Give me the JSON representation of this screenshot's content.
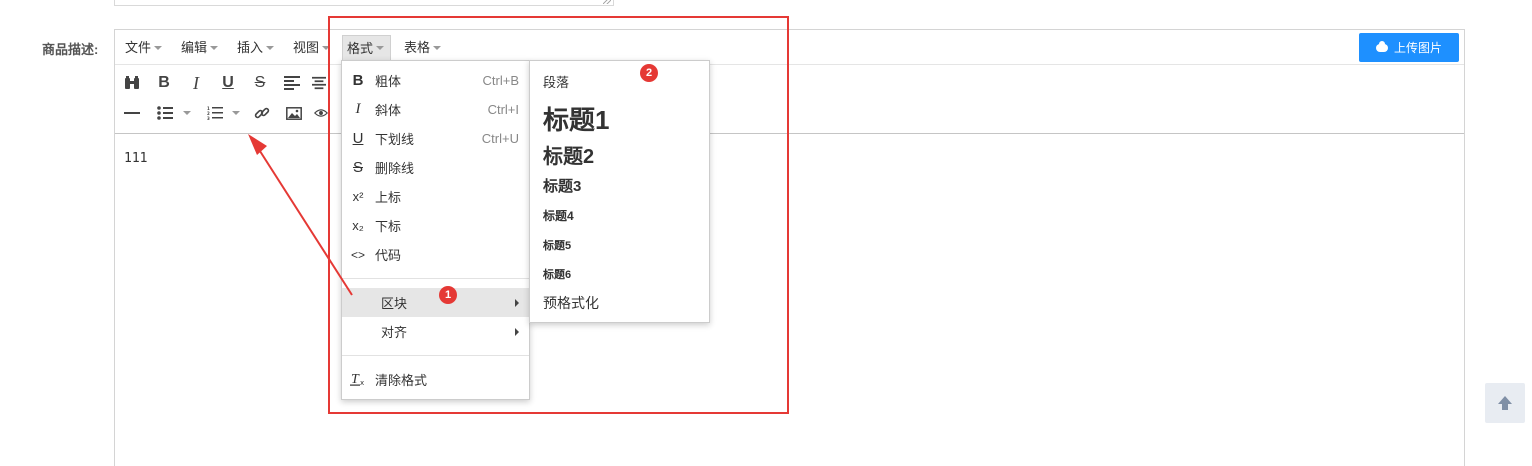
{
  "field_label": "商品描述:",
  "menubar": {
    "items": [
      {
        "label": "文件"
      },
      {
        "label": "编辑"
      },
      {
        "label": "插入"
      },
      {
        "label": "视图"
      },
      {
        "label": "格式"
      },
      {
        "label": "表格"
      }
    ],
    "active": "格式"
  },
  "upload_button": {
    "label": "上传图片",
    "icon": "cloud-upload-icon",
    "color": "#1e90ff"
  },
  "toolbar": {
    "row1": [
      "find-replace-icon",
      "bold-icon",
      "italic-icon",
      "underline-icon",
      "strikethrough-icon",
      "align-left-icon",
      "align-center-icon"
    ],
    "row2": [
      "horizontal-rule-icon",
      "bullet-list-icon",
      "numbered-list-icon",
      "link-icon",
      "image-icon",
      "preview-icon"
    ]
  },
  "content": {
    "text": "111"
  },
  "format_menu": {
    "items": [
      {
        "icon": "B",
        "label": "粗体",
        "shortcut": "Ctrl+B"
      },
      {
        "icon": "I",
        "label": "斜体",
        "shortcut": "Ctrl+I"
      },
      {
        "icon": "U",
        "label": "下划线",
        "shortcut": "Ctrl+U"
      },
      {
        "icon": "S",
        "label": "删除线",
        "shortcut": ""
      },
      {
        "icon": "x²",
        "label": "上标",
        "shortcut": ""
      },
      {
        "icon": "x₂",
        "label": "下标",
        "shortcut": ""
      },
      {
        "icon": "<>",
        "label": "代码",
        "shortcut": ""
      }
    ],
    "block_label": "区块",
    "align_label": "对齐",
    "clear_label": "清除格式",
    "highlight_color": "#e6e6e6"
  },
  "block_submenu": {
    "items": [
      "段落",
      "标题1",
      "标题2",
      "标题3",
      "标题4",
      "标题5",
      "标题6",
      "预格式化"
    ]
  },
  "annotations": {
    "badge1": "1",
    "badge2": "2",
    "color": "#e53935"
  }
}
